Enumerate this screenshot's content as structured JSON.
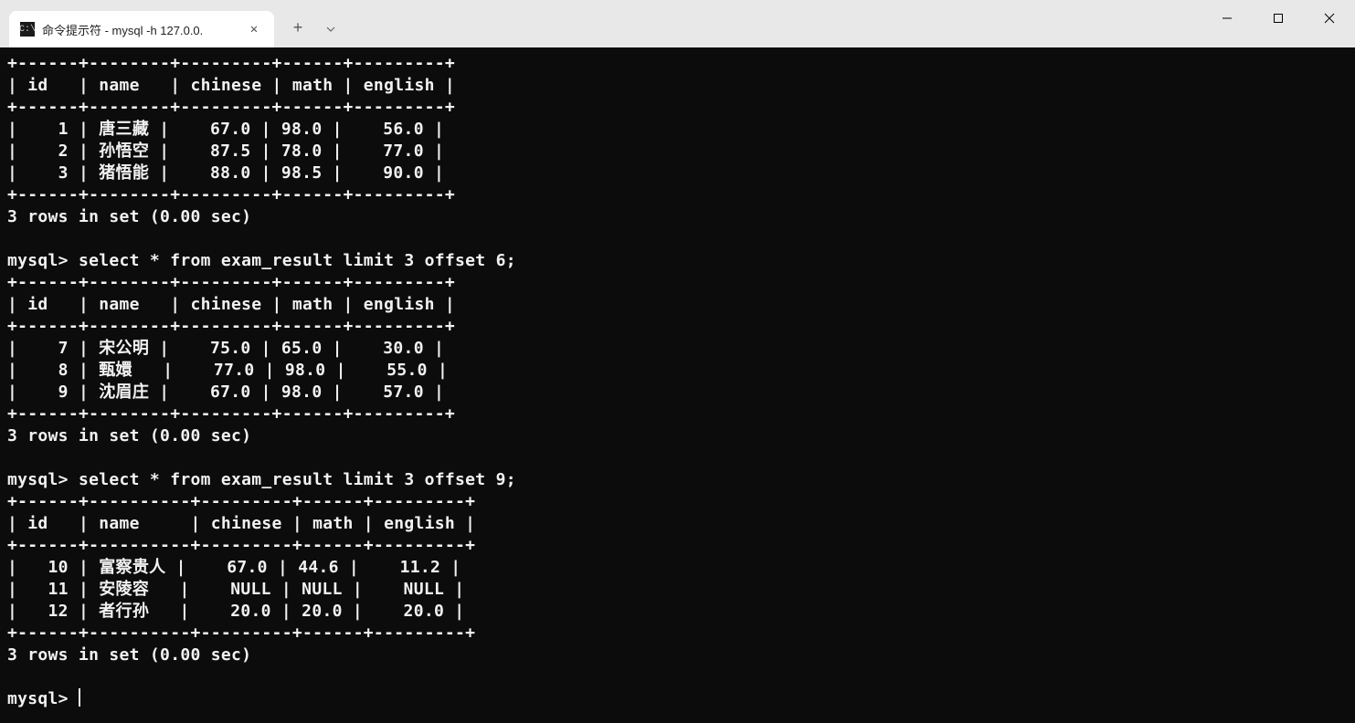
{
  "tab": {
    "title": "命令提示符 - mysql  -h 127.0.0.",
    "icon_glyph": "C:\\"
  },
  "titlebar": {
    "new_tab": "+",
    "dropdown": "⌄",
    "minimize": "—",
    "maximize": "▢",
    "close": "✕"
  },
  "terminal": {
    "prompt": "mysql> ",
    "status_msg": "3 rows in set (0.00 sec)",
    "sep1": "+------+--------+---------+------+---------+",
    "sep2": "+------+--------+---------+------+---------+",
    "sep3": "+------+----------+---------+------+---------+",
    "hdr1": "| id   | name   | chinese | math | english |",
    "hdr3": "| id   | name     | chinese | math | english |",
    "block1": {
      "rows": [
        "|    1 | 唐三藏 |    67.0 | 98.0 |    56.0 |",
        "|    2 | 孙悟空 |    87.5 | 78.0 |    77.0 |",
        "|    3 | 猪悟能 |    88.0 | 98.5 |    90.0 |"
      ]
    },
    "query2": "select * from exam_result limit 3 offset 6;",
    "block2": {
      "rows": [
        "|    7 | 宋公明 |    75.0 | 65.0 |    30.0 |",
        "|    8 | 甄嬛   |    77.0 | 98.0 |    55.0 |",
        "|    9 | 沈眉庄 |    67.0 | 98.0 |    57.0 |"
      ]
    },
    "query3": "select * from exam_result limit 3 offset 9;",
    "block3": {
      "rows": [
        "|   10 | 富察贵人 |    67.0 | 44.6 |    11.2 |",
        "|   11 | 安陵容   |    NULL | NULL |    NULL |",
        "|   12 | 者行孙   |    20.0 | 20.0 |    20.0 |"
      ]
    }
  }
}
